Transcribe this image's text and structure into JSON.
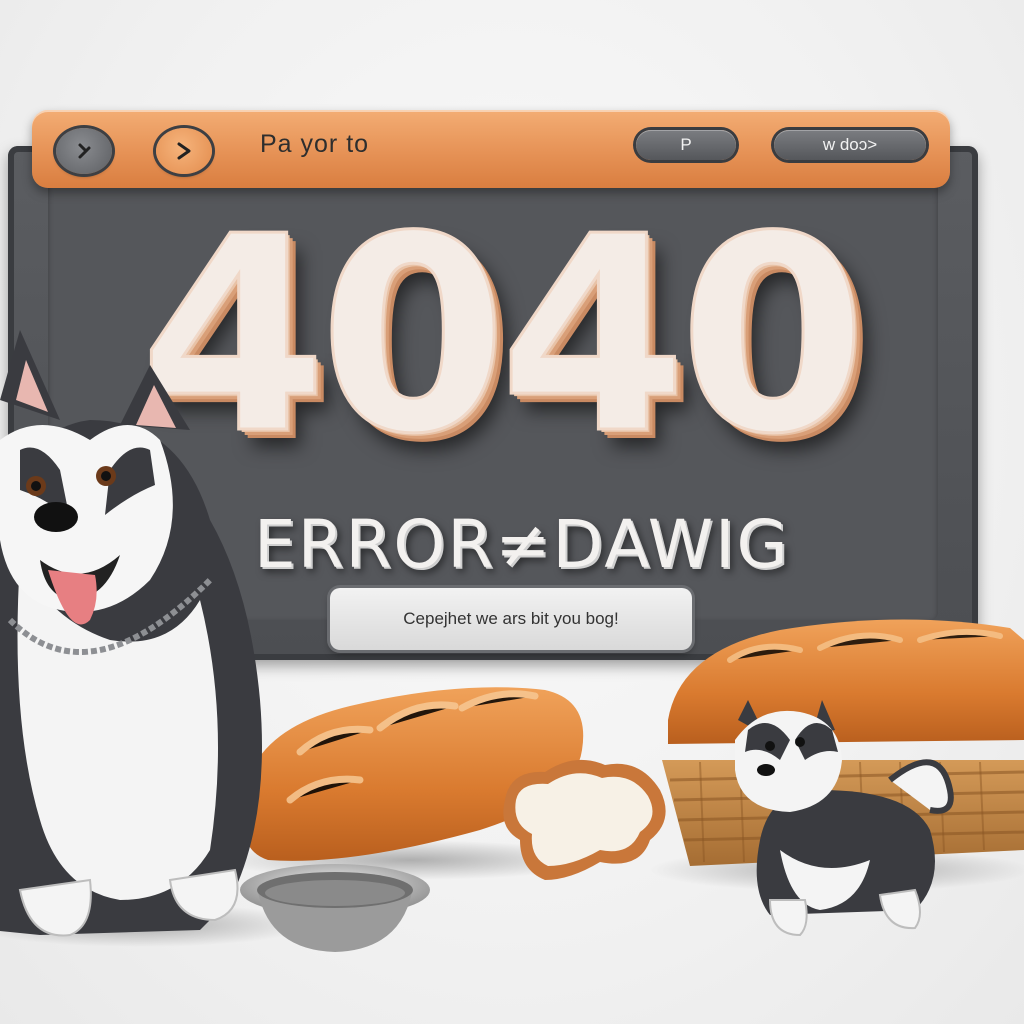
{
  "toolbar": {
    "back_icon_label": "◂",
    "forward_icon_label": "›",
    "title": "Pa yor to",
    "button_p_label": "P",
    "button_window_label": "w doɔ>"
  },
  "error": {
    "code": "4040",
    "title": "ERROR≠DAWIG",
    "message": "Cepejhet we ars bit you bog!"
  },
  "colors": {
    "toolbar": "#e69256",
    "window": "#4c4e52",
    "digits": "#f4ece6"
  }
}
